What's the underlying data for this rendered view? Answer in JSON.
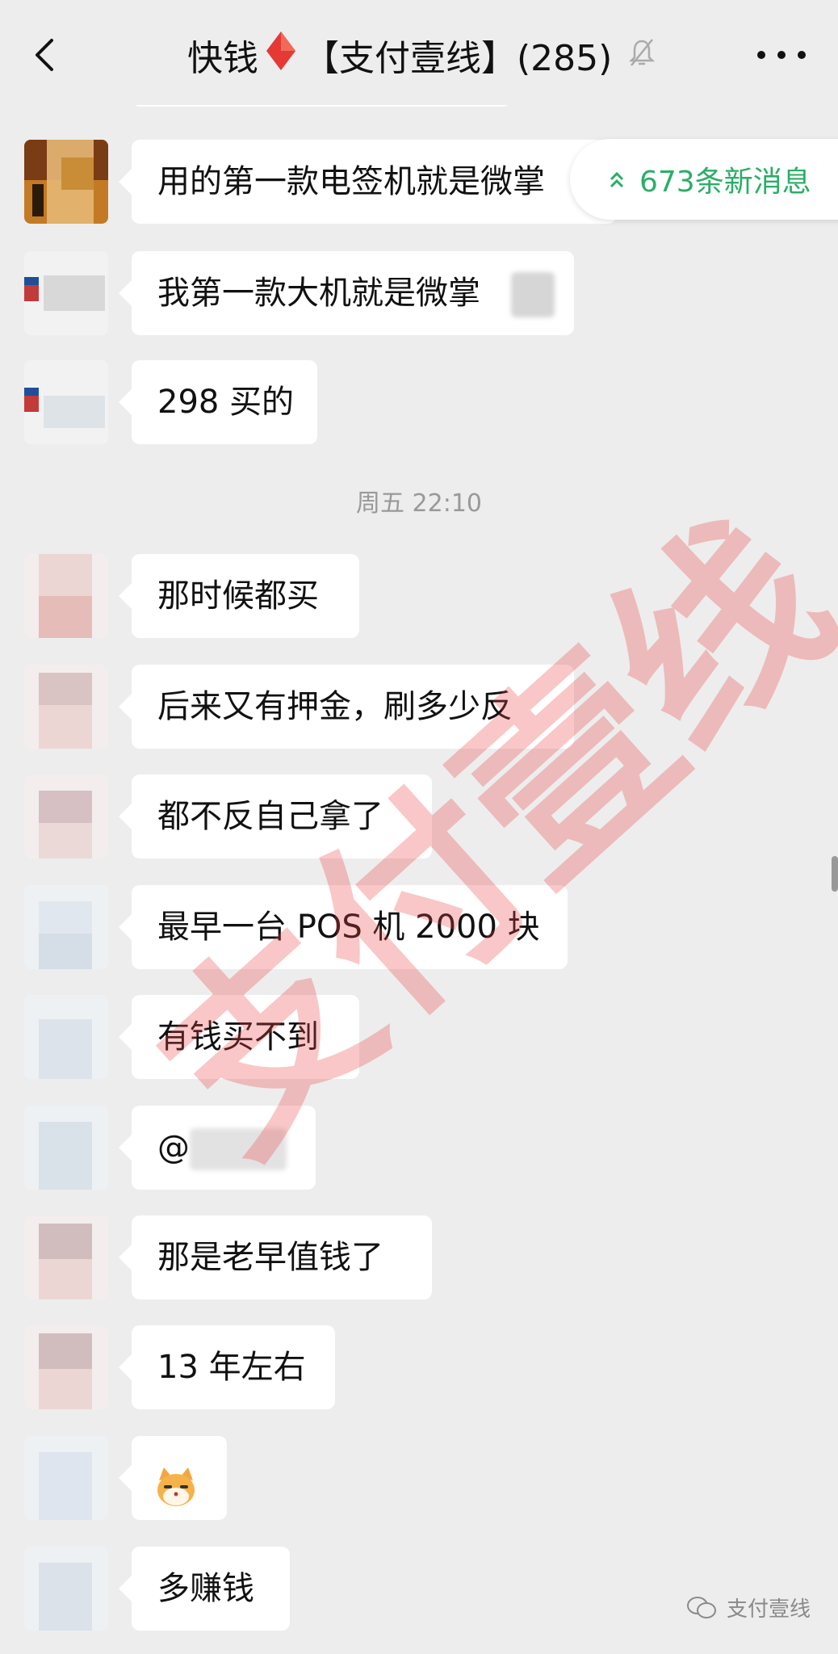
{
  "header": {
    "title_left": "快钱",
    "title_right": "【支付壹线】(285)",
    "diamond_color": "#e53935",
    "icons": [
      "back-arrow-icon",
      "diamond-icon",
      "mute-bell-icon",
      "more-icon"
    ]
  },
  "new_messages": {
    "label": "673条新消息",
    "color": "#2aae67"
  },
  "messages": [
    {
      "text": "用的第一款电签机就是微掌"
    },
    {
      "text": "我第一款大机就是微掌"
    },
    {
      "text": "298 买的"
    },
    {
      "text": "那时候都买"
    },
    {
      "text": "后来又有押金，刷多少反"
    },
    {
      "text": "都不反自己拿了"
    },
    {
      "text": "最早一台 POS 机 2000 块"
    },
    {
      "text": "有钱买不到"
    },
    {
      "text": "@"
    },
    {
      "text": "那是老早值钱了"
    },
    {
      "text": "13 年左右"
    },
    {
      "text": "🐱"
    },
    {
      "text": "多赚钱"
    }
  ],
  "time_separator": "周五 22:10",
  "watermark": "支付壹线",
  "footer": {
    "account": "支付壹线"
  }
}
